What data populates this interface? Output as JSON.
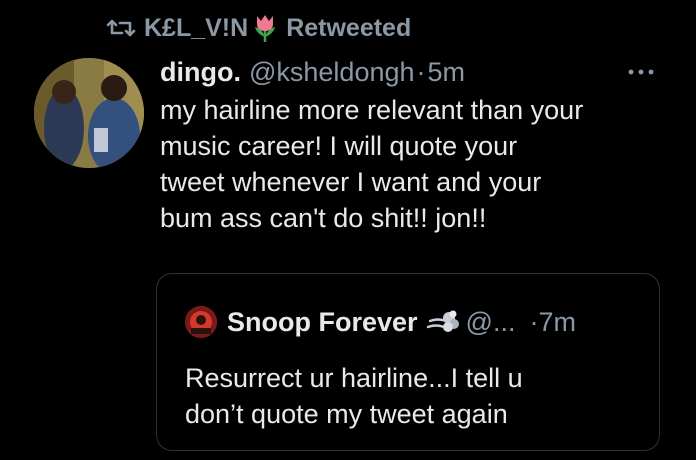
{
  "retweet": {
    "icon": "retweet-icon",
    "retweeter_name": "K£L_V!N",
    "emoji": "tulip-icon",
    "label": "Retweeted"
  },
  "tweet": {
    "avatar": "avatar",
    "author_name": "dingo.",
    "handle": "@ksheldongh",
    "separator": "·",
    "time": "5m",
    "more_icon": "more-icon",
    "text_lines": [
      "my hairline more relevant than your",
      "music career! I will quote your",
      "tweet whenever I want and your",
      "bum ass can't do shit!! jon!!"
    ]
  },
  "quote": {
    "author_name": "Snoop Forever",
    "emoji": "smoke-icon",
    "handle": "@...",
    "time": "·7m",
    "text_lines": [
      "Resurrect ur hairline...I tell u",
      "don’t quote my tweet again"
    ]
  },
  "colors": {
    "background": "#000000",
    "text": "#e7e9ea",
    "secondary": "#8b98a5",
    "border": "#2f3336"
  }
}
